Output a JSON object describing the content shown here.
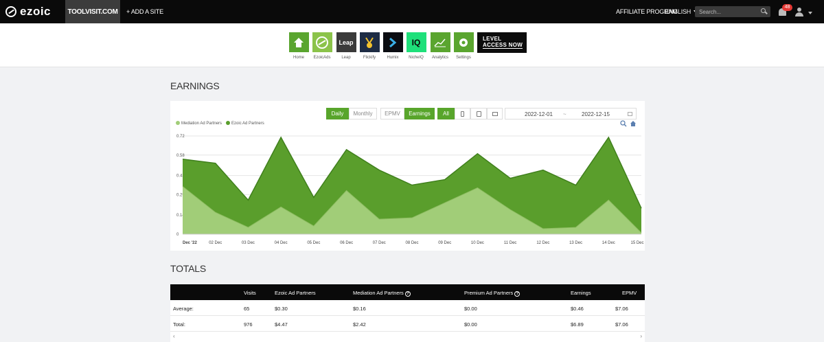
{
  "nav": {
    "logo": "ezoic",
    "site": "TOOLVISIT.COM",
    "add_site": "+ ADD A SITE",
    "affiliate": "AFFILIATE PROGRAM",
    "language": "ENGLISH",
    "search_placeholder": "Search...",
    "notifications": "48"
  },
  "apps": [
    {
      "label": "Home",
      "icon": "home-icon",
      "color": "#5aa52f"
    },
    {
      "label": "EzoicAds",
      "icon": "ezoicads-icon",
      "color": "#8bc34a"
    },
    {
      "label": "Leap",
      "icon": "leap-icon",
      "color": "#3a3a3a",
      "text": "Leap"
    },
    {
      "label": "Flickify",
      "icon": "flickify-icon",
      "color": "#1e2c44"
    },
    {
      "label": "Humix",
      "icon": "humix-icon",
      "color": "#0b0d12"
    },
    {
      "label": "NicheIQ",
      "icon": "nicheiq-icon",
      "color": "#1ee07a",
      "text": "IQ"
    },
    {
      "label": "Analytics",
      "icon": "analytics-icon",
      "color": "#5aa52f"
    },
    {
      "label": "Settings",
      "icon": "settings-icon",
      "color": "#5aa52f"
    }
  ],
  "promo": {
    "line1": "LEVEL",
    "line2": "ACCESS NOW"
  },
  "earnings": {
    "title": "EARNINGS",
    "buttons": {
      "daily": "Daily",
      "monthly": "Monthly",
      "epmv": "EPMV",
      "earnings": "Earnings",
      "all": "All"
    },
    "date_from": "2022-12-01",
    "date_sep": "~",
    "date_to": "2022-12-15"
  },
  "chart_data": {
    "type": "area",
    "stacked": true,
    "categories": [
      "Dec '22",
      "02 Dec",
      "03 Dec",
      "04 Dec",
      "05 Dec",
      "06 Dec",
      "07 Dec",
      "08 Dec",
      "09 Dec",
      "10 Dec",
      "11 Dec",
      "12 Dec",
      "13 Dec",
      "14 Dec",
      "15 Dec"
    ],
    "series": [
      {
        "name": "Mediation Ad Partners",
        "color": "#a1cd78",
        "values": [
          0.35,
          0.16,
          0.05,
          0.2,
          0.06,
          0.32,
          0.11,
          0.12,
          0.23,
          0.34,
          0.18,
          0.04,
          0.05,
          0.25,
          0.01
        ]
      },
      {
        "name": "Ezoic Ad Partners",
        "color": "#5a9e2c",
        "values": [
          0.2,
          0.36,
          0.2,
          0.51,
          0.21,
          0.3,
          0.36,
          0.24,
          0.17,
          0.25,
          0.23,
          0.43,
          0.31,
          0.46,
          0.18
        ]
      }
    ],
    "yticks": [
      "0",
      "0.14",
      "0.29",
      "0.43",
      "0.58",
      "0.72"
    ],
    "ylim": [
      0,
      0.72
    ],
    "legend": "top-left",
    "grid": true
  },
  "totals": {
    "title": "TOTALS",
    "headers": [
      "",
      "Visits",
      "Ezoic Ad Partners",
      "Mediation Ad Partners",
      "Premium Ad Partners",
      "Earnings",
      "EPMV"
    ],
    "rows": [
      {
        "label": "Average:",
        "visits": "65",
        "ezoic": "$0.30",
        "mediation": "$0.16",
        "premium": "$0.00",
        "earnings": "$0.46",
        "epmv": "$7.06"
      },
      {
        "label": "Total:",
        "visits": "976",
        "ezoic": "$4.47",
        "mediation": "$2.42",
        "premium": "$0.00",
        "earnings": "$6.89",
        "epmv": "$7.06"
      }
    ]
  }
}
